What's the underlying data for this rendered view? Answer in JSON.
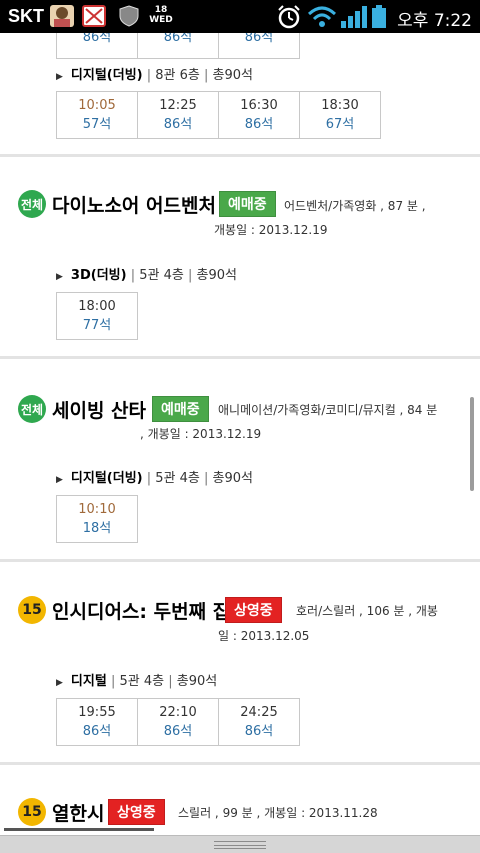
{
  "statusbar": {
    "carrier": "SKT",
    "time": "오후 7:22",
    "icons": [
      "avatar-icon",
      "notification-icon",
      "shield-icon",
      "calendar-icon",
      "alarm-icon",
      "wifi-icon",
      "signal-icon",
      "battery-icon"
    ],
    "calendar_day": "18",
    "calendar_weekday": "WED"
  },
  "top_partial": {
    "seats": [
      "86석",
      "86석",
      "86석"
    ],
    "hall": {
      "type": "디지털(더빙)",
      "screen": "8관 6층",
      "total": "총90석"
    },
    "showtimes": [
      {
        "time": "10:05",
        "seats": "57석"
      },
      {
        "time": "12:25",
        "seats": "86석"
      },
      {
        "time": "16:30",
        "seats": "86석"
      },
      {
        "time": "18:30",
        "seats": "67석"
      }
    ]
  },
  "movies": [
    {
      "rating": "전체",
      "title": "다이노소어 어드벤처",
      "status": "예매중",
      "genre_runtime": "어드벤처/가족영화 , 87 분 ,",
      "release": "개봉일 : 2013.12.19",
      "hall": {
        "type": "3D(더빙)",
        "screen": "5관 4층",
        "total": "총90석"
      },
      "showtimes": [
        {
          "time": "18:00",
          "seats": "77석"
        }
      ]
    },
    {
      "rating": "전체",
      "title": "세이빙 산타",
      "status": "예매중",
      "genre_runtime": "애니메이션/가족영화/코미디/뮤지컬 , 84 분",
      "release": ",    개봉일 : 2013.12.19",
      "hall": {
        "type": "디지털(더빙)",
        "screen": "5관 4층",
        "total": "총90석"
      },
      "showtimes": [
        {
          "time": "10:10",
          "seats": "18석"
        }
      ]
    },
    {
      "rating": "15",
      "title": "인시디어스: 두번째 집",
      "status": "상영중",
      "genre_runtime": "호러/스릴러 , 106 분 ,    개봉",
      "release": "일 : 2013.12.05",
      "hall": {
        "type": "디지털",
        "screen": "5관 4층",
        "total": "총90석"
      },
      "showtimes": [
        {
          "time": "19:55",
          "seats": "86석"
        },
        {
          "time": "22:10",
          "seats": "86석"
        },
        {
          "time": "24:25",
          "seats": "86석"
        }
      ]
    },
    {
      "rating": "15",
      "title": "열한시",
      "status": "상영중",
      "genre_runtime": "스릴러 , 99 분 ,   개봉일 : 2013.11.28"
    }
  ],
  "colors": {
    "status_bar": "#000000",
    "rating_all": "#2fa84f",
    "rating_15": "#f2b600",
    "booking_green": "#4aa84a",
    "showing_red": "#e32222",
    "seat_blue": "#2e6fa3",
    "time_brown": "#a0693a"
  }
}
